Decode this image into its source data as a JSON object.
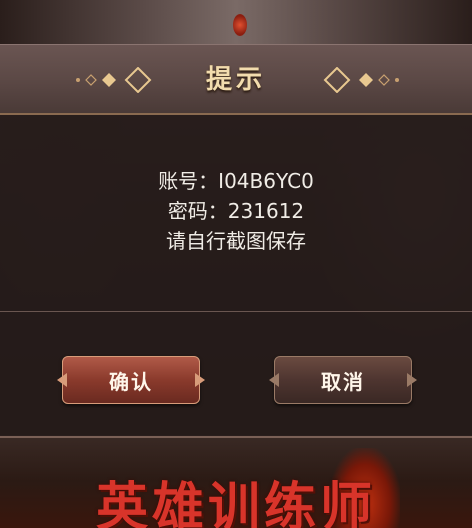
{
  "dialog": {
    "title": "提示",
    "lines": [
      "账号：I04B6YC0",
      "密码：231612",
      "请自行截图保存"
    ],
    "confirm_label": "确认",
    "cancel_label": "取消"
  },
  "background": {
    "game_title": "英雄训练师"
  },
  "colors": {
    "title": "#f2dcae",
    "text": "#f0ece6",
    "confirm": "#8a3a2c",
    "cancel": "#4e3530",
    "game_title": "#d8342a"
  }
}
